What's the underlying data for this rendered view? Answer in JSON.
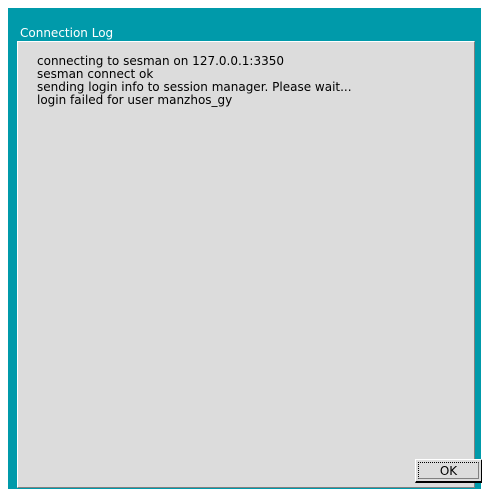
{
  "window": {
    "title": "Connection Log"
  },
  "log": {
    "lines": [
      "connecting to sesman on 127.0.0.1:3350",
      "sesman connect ok",
      "sending login info to session manager. Please wait...",
      "login failed for user manzhos_gy"
    ]
  },
  "buttons": {
    "ok_label": "OK"
  },
  "colors": {
    "frame": "#009aaa",
    "body": "#dcdcdc",
    "title_text": "#ffffff"
  }
}
